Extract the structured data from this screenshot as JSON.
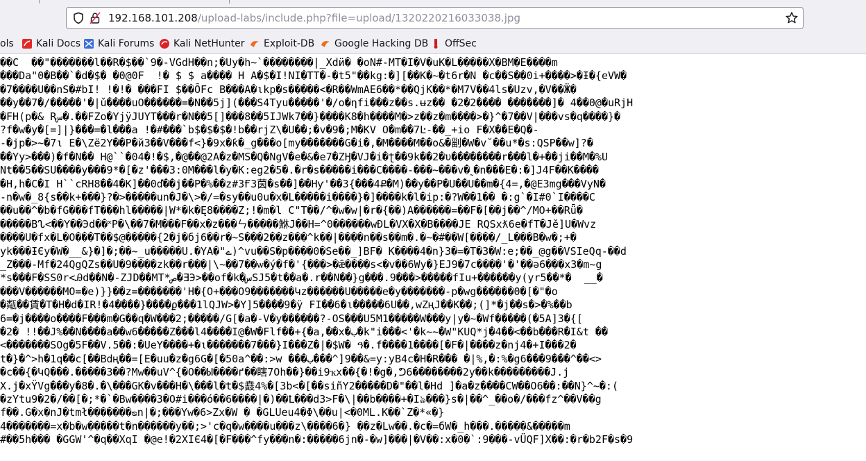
{
  "browser": {
    "url_host": "192.168.101.208",
    "url_path": "/upload-labs/include.php?file=upload/1320220216033038.jpg"
  },
  "bookmarks": [
    {
      "label": "ols",
      "icon": "none"
    },
    {
      "label": "Kali Docs",
      "icon": "kali-docs-icon"
    },
    {
      "label": "Kali Forums",
      "icon": "kali-forums-icon"
    },
    {
      "label": "Kali NetHunter",
      "icon": "kali-nethunter-icon"
    },
    {
      "label": "Exploit-DB",
      "icon": "exploit-db-icon"
    },
    {
      "label": "Google Hacking DB",
      "icon": "ghdb-icon"
    },
    {
      "label": "OffSec",
      "icon": "offsec-icon"
    }
  ],
  "content": {
    "lines": [
      "��C  ��\"�������l��R�$��`9�-VGdH��n;�Uy�h~`��������|_Xdӥ� �oN#-MT�I�V�uK�L�����X�BM�E����m",
      "���Da\"0�B��`�d�$� �0@0F  !� $ $ a���� H A�$�I!NI�TT�-�t5\"��kg:�][��K�~�t6r�N �c��S��0i+����>�Ɨ�{eVW�",
      "�7����U��nS�#bI! !�!� ���FI $��ÕFc B���A�ιkp�s�����<�R��WmAE6��*��QjK��*�M7V��4ls�Uzv,�V��Ӝ�",
      "��y��7�/�����'�|ǔ����uO������=�N��5j](���S4Tyu�����'�/o�ηfi���z��s.ʉz�� �2�2���� �������]� 4��0@�uRjH",
      "�FH(p�& Rس�.��FZo�YjÿJUYT���r�N��5[]���8��5IJWk7��}����K8�h����M�>z��z�m����>�}^�7��V|���vs�q����}�",
      "?f�w�y�[=]|}���=�l���a !�#���`b$�$�$�!b��rjZ\\�U��;�v�9�;M�KV O�m��7Ŀ-��_+io F�X��E�Q�-",
      "-�jp�>~�7ι E�\\Zë2Y��P�й3��V���f<}�9x�ƙ�_g���o[my�������G�i�,�M����M��o&�㓯�W�v˘��u*�s:QSP��w]?�",
      "��Yy>���)�f�N�� H@``�04�!�$,�@��@2A�z�MS�Q�NgV�e�&�e7�ZӇ�VJ�i�ʈ��9k��2�υ��������r���l�+��ji��M�%U",
      "Nt��5��SU����y���9*�[�z'���3:0M���l�y�K:eg2�5�.�r�s�����i���C����-���~���v�˷�n���E�:�]J4F��K����",
      "�H,h�C�I H``cRH8��4�K]��0ď��j��P�%��z#3Ғ3茵�s��]��Hƴ'��3{���4Ք�M)��y��P�U��U��m�{4=,�@E3mg���VyN�",
      "-n�w�_8{s��k+���}?�>�����un�J�\\>�/=�sy��u0u�x�L�����i����}�]����k�l�ip:�?W��1�� �:g`�I#0`I����C",
      "��u��^�b�fG���fT���hl�����|W*�k�Ę8����Z;!�m�l C\"T��/^�w�w|�r�{��)A������=��F�[��j��^/MO+��Rǖ�",
      "�����Bᔐ<��Y��Эd��˟P�\\��7�M���F��x�z���ㄣ�����鮴J��H=^0������wĐL�VX�X�B����JE RQSxƛ6e�fT�Jě]U�Wvz",
      "����U�fx�L�Ο���T��$@�����{2�j�бj6��r�~S���2��z���^k��|����n��s��m�.�~�#��W[����/_L���B�w�;+�",
      "yk���ƗЄy�W�__&}�]�;��~_u�����U.�YA�\"ے)^vu��S�p����0�Se��_]BF� K����4�n}3�=�T�3�W:e;��_@g��VSIeQq-��d",
      "_Z���-Mf�24QgQZs��U�9����zk��r���|\\~��7��ѡ�ý�f�'{���>�ǣ����s<�v��6Wy�}EJ9�7c����'�'��ǝ6���x3�m~g",
      "*s���F�SS0r<Ꭿd��N�-ZJD��MT*ص�ƎЭ>��of�k�سSJ5�t��a�.r��N��}g���.9���>�����fIu+������y(yr5��*�  __�",
      "���V������MO=�e)}}��z=�������'H�{O+���O9�������Կz������U�����e�y�������-p�wg������0�[�\"�o",
      "�甐��賃�T�H�d�IR!�4����}����ϼ���1lQJW>�Y]5����9�ÿ FI��6�ι�����6U��,wZңJ��K��;(]*�j��s�>�%��b",
      "6=�j����o����F���m�G��q�W���2;�����/G[�a�-V�y������?-OS���U5M1�����W���y|y�~�Wf�����(�5A]3�{[",
      "�2� !!��J%��N����a��w6�����Z���l4����I@�W�Flf��+{�a,��x�ب�k\"i���<'�k~~�W\"KUQ*j�4��<��b���R�I&t ��",
      "<�������SOg�5F��V.5��:�UeY����+�ι�������7���}I���Z�|�$W� ዓ�.f����1����[�F�|����z�nj4�+I���2�",
      "t�}�^>h�1q��c[��Bdң��=[E�uu�z�g6G�[�50a^��:>w ���ب���^]9��&=y:yB4c�H�R��� �|%,�:%�g6���9���^��<>",
      "�c��{�ԿQ���.�����3��?Mw��uV^{�O��Ы����ґ��瞎7Oh��}��i9ҡx��{�!�g�,ᕤ6��������2y��k���������J.j",
      "X.j�xŸVg���y�8�.�\\���GK�v���H�\\���l�t�$鼖4%�[3b<�[��siñY2�����D�\"��l�Hd ]�a�z����CW��O6��:��N}^~�:(",
      "�zYtu9�2�/��[�;*�`�Bw����3�O#i���ó��6����|�)��Ꝉ���d3>F�\\|��b����+�Iঌ���}s�|��^_��o�/���fz^��V��g",
      "f��.G�x�nJ�tmł�������ᴓn|�;���Yw�6>Zx�W � �GLUeu4�Φ\\��u|<�0ML.K��`Z�*«�}",
      "4�������=x�b�w�����t�n������y��;>'c�q�w����u���z\\����6�} ��z�Lw��.�c�=бW�_h���.�����&�����m",
      "#��5h��� �GGW'^�q��XqI �@e!�2XIЄ4�[�F���^fy���n�:�����6jn�-�w]���|�V��:x�0�`:9���-vÜQF]X��:�r�b2F�s�9"
    ]
  }
}
